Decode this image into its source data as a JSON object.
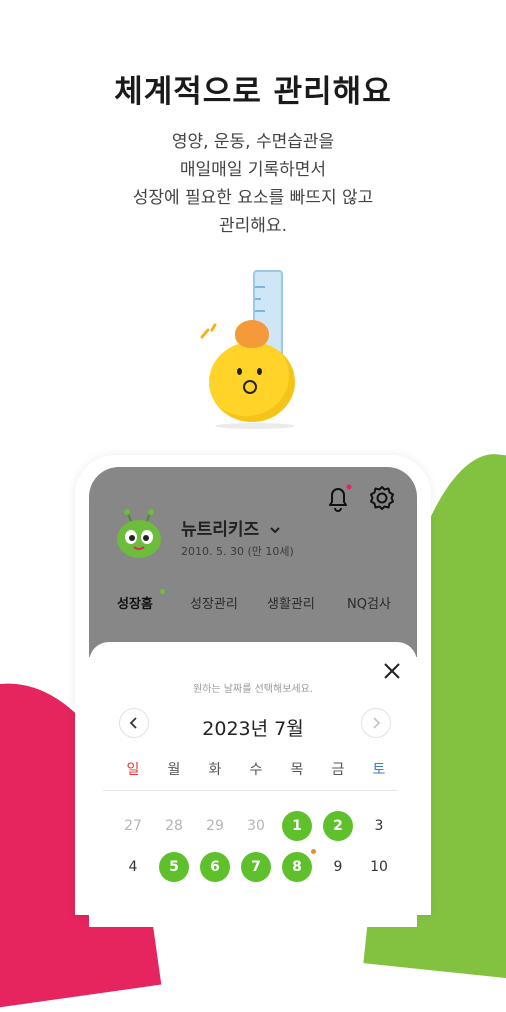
{
  "headline": "체계적으로 관리해요",
  "description": [
    "영양, 운동, 수면습관을",
    "매일매일 기록하면서",
    "성장에 필요한 요소를 빠뜨지 않고",
    "관리해요."
  ],
  "app": {
    "profile": {
      "name": "뉴트리키즈",
      "birth": "2010. 5. 30 (만 10세)"
    },
    "tabs": [
      "성장홈",
      "성장관리",
      "생활관리",
      "NQ검사"
    ],
    "active_tab": "성장홈",
    "calendar": {
      "hint": "원하는 날짜를 선택해보세요.",
      "month": "2023년 7월",
      "weekdays": [
        "일",
        "월",
        "화",
        "수",
        "목",
        "금",
        "토"
      ],
      "rows": [
        [
          {
            "d": "27",
            "muted": true
          },
          {
            "d": "28",
            "muted": true
          },
          {
            "d": "29",
            "muted": true
          },
          {
            "d": "30",
            "muted": true
          },
          {
            "d": "1",
            "marked": true
          },
          {
            "d": "2",
            "marked": true
          },
          {
            "d": "3"
          }
        ],
        [
          {
            "d": "4"
          },
          {
            "d": "5",
            "marked": true
          },
          {
            "d": "6",
            "marked": true
          },
          {
            "d": "7",
            "marked": true
          },
          {
            "d": "8",
            "marked": true,
            "dot": true
          },
          {
            "d": "9"
          },
          {
            "d": "10"
          }
        ]
      ]
    }
  },
  "colors": {
    "accent_green": "#5ec12b",
    "pink": "#e6245d",
    "sunday": "#e53935",
    "saturday": "#3b82c4",
    "orange_dot": "#f08a2e"
  },
  "icons": [
    "bell-icon",
    "gear-icon",
    "chevron-down-icon",
    "close-icon",
    "chevron-left-icon",
    "chevron-right-icon"
  ]
}
